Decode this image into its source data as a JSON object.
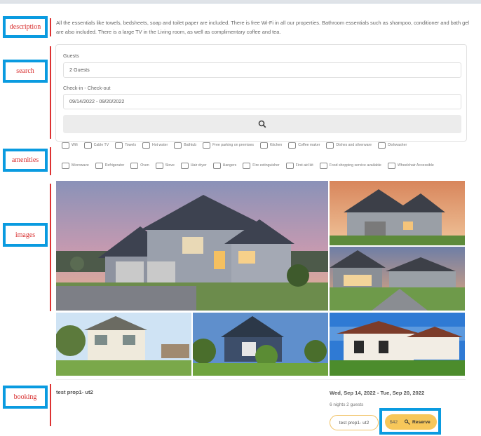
{
  "annotations": {
    "description": "description",
    "search": "search",
    "amenities": "amenities",
    "images": "images",
    "booking": "booking"
  },
  "description": "All the essentials like towels, bedsheets, soap and toilet paper are included. There is free Wi-Fi in all our properties. Bathroom essentials such as shampoo, conditioner and bath gel are also included. There is a large TV in the Living room, as well as complimentary coffee and tea.",
  "search": {
    "guests_label": "Guests",
    "guests_value": "2 Guests",
    "dates_label": "Check-in - Check-out",
    "dates_value": "09/14/2022 - 09/20/2022",
    "button_icon": "search-icon"
  },
  "amenities": {
    "row1": [
      {
        "label": "Wifi",
        "icon": "wifi-icon"
      },
      {
        "label": "Cable TV",
        "icon": "tv-icon"
      },
      {
        "label": "Towels",
        "icon": "towel-icon"
      },
      {
        "label": "Hot water",
        "icon": "hot-water-icon"
      },
      {
        "label": "Bathtub",
        "icon": "bathtub-icon"
      },
      {
        "label": "Free parking on premises",
        "icon": "parking-icon"
      },
      {
        "label": "Kitchen",
        "icon": "kitchen-icon"
      },
      {
        "label": "Coffee maker",
        "icon": "coffee-maker-icon"
      },
      {
        "label": "Dishes and silverware",
        "icon": "dishes-icon"
      },
      {
        "label": "Dishwasher",
        "icon": "dishwasher-icon"
      }
    ],
    "row2": [
      {
        "label": "Microwave",
        "icon": "microwave-icon"
      },
      {
        "label": "Refrigerator",
        "icon": "refrigerator-icon"
      },
      {
        "label": "Oven",
        "icon": "oven-icon"
      },
      {
        "label": "Stove",
        "icon": "stove-icon"
      },
      {
        "label": "Hair dryer",
        "icon": "hair-dryer-icon"
      },
      {
        "label": "Hangers",
        "icon": "hanger-icon"
      },
      {
        "label": "Fire extinguisher",
        "icon": "fire-extinguisher-icon"
      },
      {
        "label": "First aid kit",
        "icon": "first-aid-icon"
      },
      {
        "label": "Food shopping service available",
        "icon": "shopping-bag-icon"
      },
      {
        "label": "Wheelchair Accessible",
        "icon": "wheelchair-icon"
      }
    ]
  },
  "booking": {
    "title": "test prop1- ut2",
    "dates": "Wed, Sep 14, 2022 - Tue, Sep 20, 2022",
    "summary": "6 nights 2 guests",
    "property_pill": "test prop1- ut2",
    "price": "$42",
    "reserve_label": "Reserve"
  },
  "colors": {
    "annotation_border": "#0a9be0",
    "annotation_text": "#d83030",
    "reserve_bg": "#f7c75a"
  }
}
